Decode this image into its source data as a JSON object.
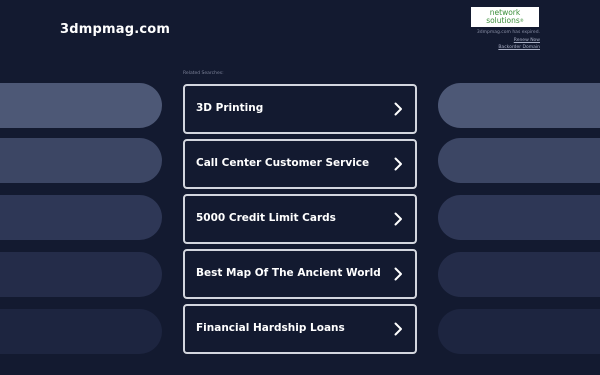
{
  "site": {
    "title": "3dmpmag.com"
  },
  "logo": {
    "line1": "network",
    "line2": "solutions",
    "reg_mark": "®"
  },
  "notice": {
    "text": "3dmpmag.com has expired.",
    "renew_label": "Renew Now",
    "backorder_label": "Backorder Domain"
  },
  "related": {
    "label": "Related Searches:",
    "items": [
      {
        "label": "3D Printing",
        "icon": "chevron-right-icon"
      },
      {
        "label": "Call Center Customer Service",
        "icon": "chevron-right-icon"
      },
      {
        "label": "5000 Credit Limit Cards",
        "icon": "chevron-right-icon"
      },
      {
        "label": "Best Map Of The Ancient World",
        "icon": "chevron-right-icon"
      },
      {
        "label": "Financial Hardship Loans",
        "icon": "chevron-right-icon"
      }
    ]
  },
  "colors": {
    "background": "#131a30",
    "box_border": "#d3d6de",
    "logo_green": "#3b8f3a"
  }
}
